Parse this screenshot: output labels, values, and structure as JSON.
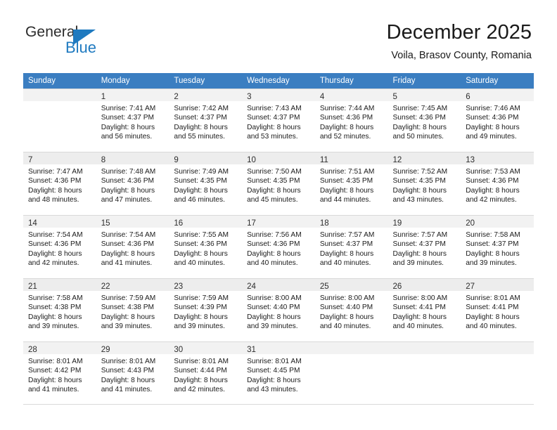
{
  "brand": {
    "name_part1": "General",
    "name_part2": "Blue",
    "accent_color": "#1f7ac0"
  },
  "header": {
    "month_title": "December 2025",
    "location": "Voila, Brasov County, Romania"
  },
  "calendar": {
    "header_bg": "#3b7ec1",
    "weekdays": [
      "Sunday",
      "Monday",
      "Tuesday",
      "Wednesday",
      "Thursday",
      "Friday",
      "Saturday"
    ],
    "weeks": [
      [
        {
          "day": "",
          "lines": []
        },
        {
          "day": "1",
          "lines": [
            "Sunrise: 7:41 AM",
            "Sunset: 4:37 PM",
            "Daylight: 8 hours",
            "and 56 minutes."
          ]
        },
        {
          "day": "2",
          "lines": [
            "Sunrise: 7:42 AM",
            "Sunset: 4:37 PM",
            "Daylight: 8 hours",
            "and 55 minutes."
          ]
        },
        {
          "day": "3",
          "lines": [
            "Sunrise: 7:43 AM",
            "Sunset: 4:37 PM",
            "Daylight: 8 hours",
            "and 53 minutes."
          ]
        },
        {
          "day": "4",
          "lines": [
            "Sunrise: 7:44 AM",
            "Sunset: 4:36 PM",
            "Daylight: 8 hours",
            "and 52 minutes."
          ]
        },
        {
          "day": "5",
          "lines": [
            "Sunrise: 7:45 AM",
            "Sunset: 4:36 PM",
            "Daylight: 8 hours",
            "and 50 minutes."
          ]
        },
        {
          "day": "6",
          "lines": [
            "Sunrise: 7:46 AM",
            "Sunset: 4:36 PM",
            "Daylight: 8 hours",
            "and 49 minutes."
          ]
        }
      ],
      [
        {
          "day": "7",
          "lines": [
            "Sunrise: 7:47 AM",
            "Sunset: 4:36 PM",
            "Daylight: 8 hours",
            "and 48 minutes."
          ]
        },
        {
          "day": "8",
          "lines": [
            "Sunrise: 7:48 AM",
            "Sunset: 4:36 PM",
            "Daylight: 8 hours",
            "and 47 minutes."
          ]
        },
        {
          "day": "9",
          "lines": [
            "Sunrise: 7:49 AM",
            "Sunset: 4:35 PM",
            "Daylight: 8 hours",
            "and 46 minutes."
          ]
        },
        {
          "day": "10",
          "lines": [
            "Sunrise: 7:50 AM",
            "Sunset: 4:35 PM",
            "Daylight: 8 hours",
            "and 45 minutes."
          ]
        },
        {
          "day": "11",
          "lines": [
            "Sunrise: 7:51 AM",
            "Sunset: 4:35 PM",
            "Daylight: 8 hours",
            "and 44 minutes."
          ]
        },
        {
          "day": "12",
          "lines": [
            "Sunrise: 7:52 AM",
            "Sunset: 4:35 PM",
            "Daylight: 8 hours",
            "and 43 minutes."
          ]
        },
        {
          "day": "13",
          "lines": [
            "Sunrise: 7:53 AM",
            "Sunset: 4:36 PM",
            "Daylight: 8 hours",
            "and 42 minutes."
          ]
        }
      ],
      [
        {
          "day": "14",
          "lines": [
            "Sunrise: 7:54 AM",
            "Sunset: 4:36 PM",
            "Daylight: 8 hours",
            "and 42 minutes."
          ]
        },
        {
          "day": "15",
          "lines": [
            "Sunrise: 7:54 AM",
            "Sunset: 4:36 PM",
            "Daylight: 8 hours",
            "and 41 minutes."
          ]
        },
        {
          "day": "16",
          "lines": [
            "Sunrise: 7:55 AM",
            "Sunset: 4:36 PM",
            "Daylight: 8 hours",
            "and 40 minutes."
          ]
        },
        {
          "day": "17",
          "lines": [
            "Sunrise: 7:56 AM",
            "Sunset: 4:36 PM",
            "Daylight: 8 hours",
            "and 40 minutes."
          ]
        },
        {
          "day": "18",
          "lines": [
            "Sunrise: 7:57 AM",
            "Sunset: 4:37 PM",
            "Daylight: 8 hours",
            "and 40 minutes."
          ]
        },
        {
          "day": "19",
          "lines": [
            "Sunrise: 7:57 AM",
            "Sunset: 4:37 PM",
            "Daylight: 8 hours",
            "and 39 minutes."
          ]
        },
        {
          "day": "20",
          "lines": [
            "Sunrise: 7:58 AM",
            "Sunset: 4:37 PM",
            "Daylight: 8 hours",
            "and 39 minutes."
          ]
        }
      ],
      [
        {
          "day": "21",
          "lines": [
            "Sunrise: 7:58 AM",
            "Sunset: 4:38 PM",
            "Daylight: 8 hours",
            "and 39 minutes."
          ]
        },
        {
          "day": "22",
          "lines": [
            "Sunrise: 7:59 AM",
            "Sunset: 4:38 PM",
            "Daylight: 8 hours",
            "and 39 minutes."
          ]
        },
        {
          "day": "23",
          "lines": [
            "Sunrise: 7:59 AM",
            "Sunset: 4:39 PM",
            "Daylight: 8 hours",
            "and 39 minutes."
          ]
        },
        {
          "day": "24",
          "lines": [
            "Sunrise: 8:00 AM",
            "Sunset: 4:40 PM",
            "Daylight: 8 hours",
            "and 39 minutes."
          ]
        },
        {
          "day": "25",
          "lines": [
            "Sunrise: 8:00 AM",
            "Sunset: 4:40 PM",
            "Daylight: 8 hours",
            "and 40 minutes."
          ]
        },
        {
          "day": "26",
          "lines": [
            "Sunrise: 8:00 AM",
            "Sunset: 4:41 PM",
            "Daylight: 8 hours",
            "and 40 minutes."
          ]
        },
        {
          "day": "27",
          "lines": [
            "Sunrise: 8:01 AM",
            "Sunset: 4:41 PM",
            "Daylight: 8 hours",
            "and 40 minutes."
          ]
        }
      ],
      [
        {
          "day": "28",
          "lines": [
            "Sunrise: 8:01 AM",
            "Sunset: 4:42 PM",
            "Daylight: 8 hours",
            "and 41 minutes."
          ]
        },
        {
          "day": "29",
          "lines": [
            "Sunrise: 8:01 AM",
            "Sunset: 4:43 PM",
            "Daylight: 8 hours",
            "and 41 minutes."
          ]
        },
        {
          "day": "30",
          "lines": [
            "Sunrise: 8:01 AM",
            "Sunset: 4:44 PM",
            "Daylight: 8 hours",
            "and 42 minutes."
          ]
        },
        {
          "day": "31",
          "lines": [
            "Sunrise: 8:01 AM",
            "Sunset: 4:45 PM",
            "Daylight: 8 hours",
            "and 43 minutes."
          ]
        },
        {
          "day": "",
          "lines": []
        },
        {
          "day": "",
          "lines": []
        },
        {
          "day": "",
          "lines": []
        }
      ]
    ]
  }
}
